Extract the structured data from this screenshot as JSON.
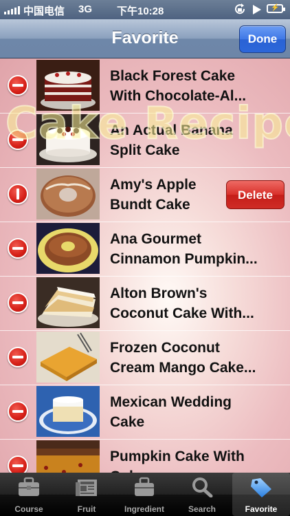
{
  "status": {
    "carrier": "中国电信",
    "network": "3G",
    "time": "下午10:28"
  },
  "nav": {
    "title": "Favorite",
    "done_label": "Done"
  },
  "watermark": "Cake Recipes",
  "rows": [
    {
      "title": "Black Forest Cake\nWith Chocolate-Al...",
      "delete_visible": false
    },
    {
      "title": "An Actual Banana\nSplit Cake",
      "delete_visible": false
    },
    {
      "title": "Amy's Apple\nBundt Cake",
      "delete_visible": true
    },
    {
      "title": "Ana Gourmet\nCinnamon Pumpkin...",
      "delete_visible": false
    },
    {
      "title": "Alton Brown's\nCoconut Cake With...",
      "delete_visible": false
    },
    {
      "title": "Frozen Coconut\nCream Mango Cake...",
      "delete_visible": false
    },
    {
      "title": "Mexican Wedding\nCake",
      "delete_visible": false
    },
    {
      "title": "Pumpkin Cake With\nCoker...",
      "delete_visible": false
    }
  ],
  "delete_label": "Delete",
  "tabs": [
    {
      "label": "Course",
      "icon": "briefcase-icon",
      "active": false
    },
    {
      "label": "Fruit",
      "icon": "newspaper-icon",
      "active": false
    },
    {
      "label": "Ingredient",
      "icon": "bag-icon",
      "active": false
    },
    {
      "label": "Search",
      "icon": "search-icon",
      "active": false
    },
    {
      "label": "Favorite",
      "icon": "tag-icon",
      "active": true
    }
  ]
}
